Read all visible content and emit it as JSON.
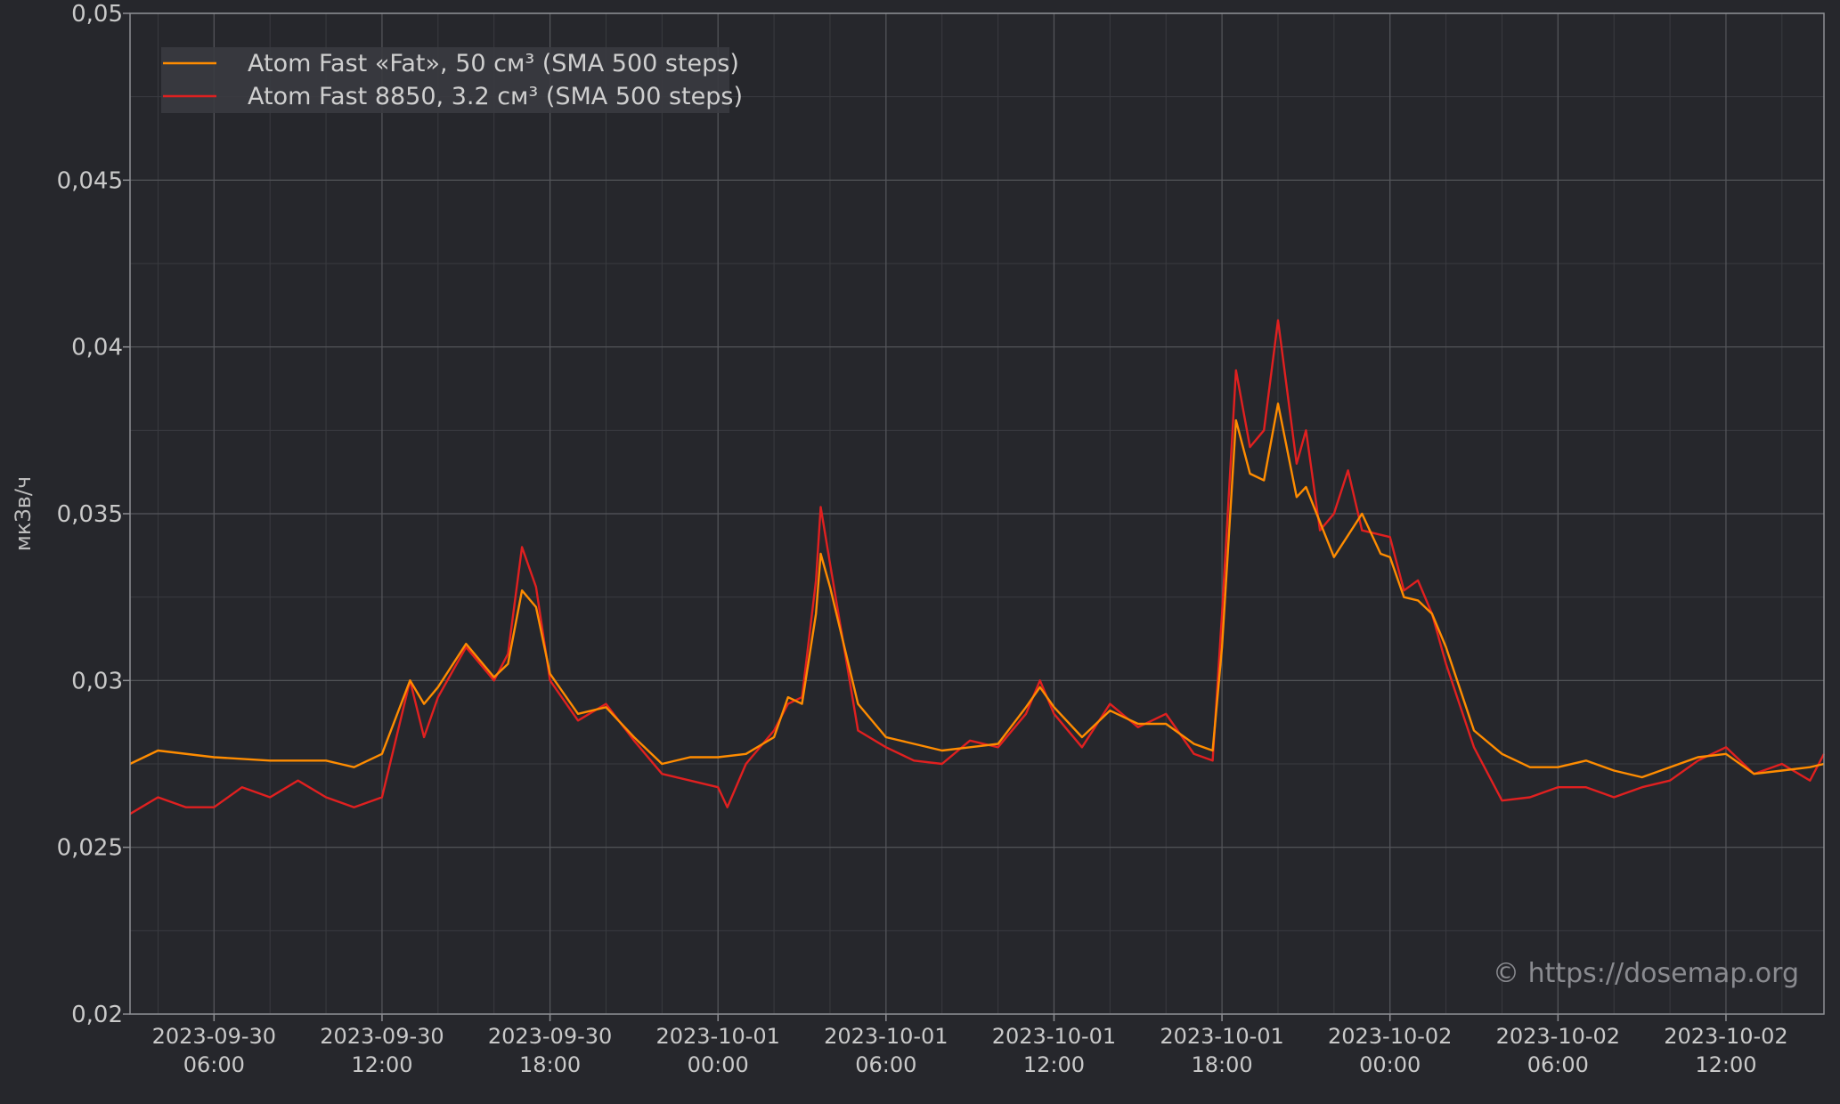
{
  "chart_data": {
    "type": "line",
    "title": "",
    "xlabel": "",
    "ylabel": "мкЗв/ч",
    "ylim": [
      0.02,
      0.05
    ],
    "y_ticks": [
      "0,02",
      "0,025",
      "0,03",
      "0,035",
      "0,04",
      "0,045",
      "0,05"
    ],
    "y_tick_values": [
      0.02,
      0.025,
      0.03,
      0.035,
      0.04,
      0.045,
      0.05
    ],
    "xlim": [
      "2023-09-30 03:00",
      "2023-10-02 15:30"
    ],
    "x_ticks": [
      {
        "date": "2023-09-30",
        "time": "06:00",
        "at": "2023-09-30 06:00"
      },
      {
        "date": "2023-09-30",
        "time": "12:00",
        "at": "2023-09-30 12:00"
      },
      {
        "date": "2023-09-30",
        "time": "18:00",
        "at": "2023-09-30 18:00"
      },
      {
        "date": "2023-10-01",
        "time": "00:00",
        "at": "2023-10-01 00:00"
      },
      {
        "date": "2023-10-01",
        "time": "06:00",
        "at": "2023-10-01 06:00"
      },
      {
        "date": "2023-10-01",
        "time": "12:00",
        "at": "2023-10-01 12:00"
      },
      {
        "date": "2023-10-01",
        "time": "18:00",
        "at": "2023-10-01 18:00"
      },
      {
        "date": "2023-10-02",
        "time": "00:00",
        "at": "2023-10-02 00:00"
      },
      {
        "date": "2023-10-02",
        "time": "06:00",
        "at": "2023-10-02 06:00"
      },
      {
        "date": "2023-10-02",
        "time": "12:00",
        "at": "2023-10-02 12:00"
      }
    ],
    "grid": true,
    "legend_position": "top-left",
    "series": [
      {
        "name": "Atom Fast «Fat», 50 см³ (SMA 500 steps)",
        "color": "#ff8c00",
        "points": [
          [
            "2023-09-30 03:00",
            0.0275
          ],
          [
            "2023-09-30 04:00",
            0.0279
          ],
          [
            "2023-09-30 06:00",
            0.0277
          ],
          [
            "2023-09-30 08:00",
            0.0276
          ],
          [
            "2023-09-30 10:00",
            0.0276
          ],
          [
            "2023-09-30 11:00",
            0.0274
          ],
          [
            "2023-09-30 12:00",
            0.0278
          ],
          [
            "2023-09-30 13:00",
            0.03
          ],
          [
            "2023-09-30 13:30",
            0.0293
          ],
          [
            "2023-09-30 14:00",
            0.0298
          ],
          [
            "2023-09-30 15:00",
            0.0311
          ],
          [
            "2023-09-30 16:00",
            0.0301
          ],
          [
            "2023-09-30 16:30",
            0.0305
          ],
          [
            "2023-09-30 17:00",
            0.0327
          ],
          [
            "2023-09-30 17:30",
            0.0322
          ],
          [
            "2023-09-30 18:00",
            0.0302
          ],
          [
            "2023-09-30 19:00",
            0.029
          ],
          [
            "2023-09-30 20:00",
            0.0292
          ],
          [
            "2023-09-30 21:00",
            0.0283
          ],
          [
            "2023-09-30 22:00",
            0.0275
          ],
          [
            "2023-09-30 23:00",
            0.0277
          ],
          [
            "2023-10-01 00:00",
            0.0277
          ],
          [
            "2023-10-01 01:00",
            0.0278
          ],
          [
            "2023-10-01 02:00",
            0.0283
          ],
          [
            "2023-10-01 02:30",
            0.0295
          ],
          [
            "2023-10-01 03:00",
            0.0293
          ],
          [
            "2023-10-01 03:30",
            0.032
          ],
          [
            "2023-10-01 03:40",
            0.0338
          ],
          [
            "2023-10-01 04:00",
            0.0328
          ],
          [
            "2023-10-01 05:00",
            0.0293
          ],
          [
            "2023-10-01 06:00",
            0.0283
          ],
          [
            "2023-10-01 07:00",
            0.0281
          ],
          [
            "2023-10-01 08:00",
            0.0279
          ],
          [
            "2023-10-01 09:00",
            0.028
          ],
          [
            "2023-10-01 10:00",
            0.0281
          ],
          [
            "2023-10-01 11:00",
            0.0292
          ],
          [
            "2023-10-01 11:30",
            0.0298
          ],
          [
            "2023-10-01 12:00",
            0.0292
          ],
          [
            "2023-10-01 13:00",
            0.0283
          ],
          [
            "2023-10-01 14:00",
            0.0291
          ],
          [
            "2023-10-01 15:00",
            0.0287
          ],
          [
            "2023-10-01 16:00",
            0.0287
          ],
          [
            "2023-10-01 17:00",
            0.0281
          ],
          [
            "2023-10-01 17:40",
            0.0279
          ],
          [
            "2023-10-01 18:00",
            0.031
          ],
          [
            "2023-10-01 18:30",
            0.0378
          ],
          [
            "2023-10-01 19:00",
            0.0362
          ],
          [
            "2023-10-01 19:30",
            0.036
          ],
          [
            "2023-10-01 20:00",
            0.0383
          ],
          [
            "2023-10-01 20:40",
            0.0355
          ],
          [
            "2023-10-01 21:00",
            0.0358
          ],
          [
            "2023-10-01 22:00",
            0.0337
          ],
          [
            "2023-10-01 23:00",
            0.035
          ],
          [
            "2023-10-01 23:40",
            0.0338
          ],
          [
            "2023-10-02 00:00",
            0.0337
          ],
          [
            "2023-10-02 00:30",
            0.0325
          ],
          [
            "2023-10-02 01:00",
            0.0324
          ],
          [
            "2023-10-02 01:30",
            0.032
          ],
          [
            "2023-10-02 02:00",
            0.031
          ],
          [
            "2023-10-02 03:00",
            0.0285
          ],
          [
            "2023-10-02 04:00",
            0.0278
          ],
          [
            "2023-10-02 05:00",
            0.0274
          ],
          [
            "2023-10-02 06:00",
            0.0274
          ],
          [
            "2023-10-02 07:00",
            0.0276
          ],
          [
            "2023-10-02 08:00",
            0.0273
          ],
          [
            "2023-10-02 09:00",
            0.0271
          ],
          [
            "2023-10-02 10:00",
            0.0274
          ],
          [
            "2023-10-02 11:00",
            0.0277
          ],
          [
            "2023-10-02 12:00",
            0.0278
          ],
          [
            "2023-10-02 13:00",
            0.0272
          ],
          [
            "2023-10-02 14:00",
            0.0273
          ],
          [
            "2023-10-02 15:00",
            0.0274
          ],
          [
            "2023-10-02 15:30",
            0.0275
          ]
        ]
      },
      {
        "name": "Atom Fast 8850, 3.2 см³ (SMA 500 steps)",
        "color": "#e02020",
        "points": [
          [
            "2023-09-30 03:00",
            0.026
          ],
          [
            "2023-09-30 04:00",
            0.0265
          ],
          [
            "2023-09-30 05:00",
            0.0262
          ],
          [
            "2023-09-30 06:00",
            0.0262
          ],
          [
            "2023-09-30 07:00",
            0.0268
          ],
          [
            "2023-09-30 08:00",
            0.0265
          ],
          [
            "2023-09-30 09:00",
            0.027
          ],
          [
            "2023-09-30 10:00",
            0.0265
          ],
          [
            "2023-09-30 11:00",
            0.0262
          ],
          [
            "2023-09-30 12:00",
            0.0265
          ],
          [
            "2023-09-30 13:00",
            0.03
          ],
          [
            "2023-09-30 13:30",
            0.0283
          ],
          [
            "2023-09-30 14:00",
            0.0295
          ],
          [
            "2023-09-30 15:00",
            0.031
          ],
          [
            "2023-09-30 16:00",
            0.03
          ],
          [
            "2023-09-30 16:30",
            0.0308
          ],
          [
            "2023-09-30 17:00",
            0.034
          ],
          [
            "2023-09-30 17:30",
            0.0328
          ],
          [
            "2023-09-30 18:00",
            0.03
          ],
          [
            "2023-09-30 19:00",
            0.0288
          ],
          [
            "2023-09-30 20:00",
            0.0293
          ],
          [
            "2023-09-30 21:00",
            0.0282
          ],
          [
            "2023-09-30 22:00",
            0.0272
          ],
          [
            "2023-09-30 23:00",
            0.027
          ],
          [
            "2023-10-01 00:00",
            0.0268
          ],
          [
            "2023-10-01 00:20",
            0.0262
          ],
          [
            "2023-10-01 01:00",
            0.0275
          ],
          [
            "2023-10-01 02:00",
            0.0285
          ],
          [
            "2023-10-01 02:30",
            0.0293
          ],
          [
            "2023-10-01 03:00",
            0.0295
          ],
          [
            "2023-10-01 03:30",
            0.033
          ],
          [
            "2023-10-01 03:40",
            0.0352
          ],
          [
            "2023-10-01 04:00",
            0.0335
          ],
          [
            "2023-10-01 05:00",
            0.0285
          ],
          [
            "2023-10-01 06:00",
            0.028
          ],
          [
            "2023-10-01 07:00",
            0.0276
          ],
          [
            "2023-10-01 08:00",
            0.0275
          ],
          [
            "2023-10-01 09:00",
            0.0282
          ],
          [
            "2023-10-01 10:00",
            0.028
          ],
          [
            "2023-10-01 11:00",
            0.029
          ],
          [
            "2023-10-01 11:30",
            0.03
          ],
          [
            "2023-10-01 12:00",
            0.029
          ],
          [
            "2023-10-01 13:00",
            0.028
          ],
          [
            "2023-10-01 14:00",
            0.0293
          ],
          [
            "2023-10-01 15:00",
            0.0286
          ],
          [
            "2023-10-01 16:00",
            0.029
          ],
          [
            "2023-10-01 17:00",
            0.0278
          ],
          [
            "2023-10-01 17:40",
            0.0276
          ],
          [
            "2023-10-01 18:00",
            0.032
          ],
          [
            "2023-10-01 18:30",
            0.0393
          ],
          [
            "2023-10-01 19:00",
            0.037
          ],
          [
            "2023-10-01 19:30",
            0.0375
          ],
          [
            "2023-10-01 20:00",
            0.0408
          ],
          [
            "2023-10-01 20:40",
            0.0365
          ],
          [
            "2023-10-01 21:00",
            0.0375
          ],
          [
            "2023-10-01 21:30",
            0.0345
          ],
          [
            "2023-10-01 22:00",
            0.035
          ],
          [
            "2023-10-01 22:30",
            0.0363
          ],
          [
            "2023-10-01 23:00",
            0.0345
          ],
          [
            "2023-10-02 00:00",
            0.0343
          ],
          [
            "2023-10-02 00:30",
            0.0327
          ],
          [
            "2023-10-02 01:00",
            0.033
          ],
          [
            "2023-10-02 01:30",
            0.032
          ],
          [
            "2023-10-02 02:00",
            0.0305
          ],
          [
            "2023-10-02 03:00",
            0.028
          ],
          [
            "2023-10-02 04:00",
            0.0264
          ],
          [
            "2023-10-02 05:00",
            0.0265
          ],
          [
            "2023-10-02 06:00",
            0.0268
          ],
          [
            "2023-10-02 07:00",
            0.0268
          ],
          [
            "2023-10-02 08:00",
            0.0265
          ],
          [
            "2023-10-02 09:00",
            0.0268
          ],
          [
            "2023-10-02 10:00",
            0.027
          ],
          [
            "2023-10-02 11:00",
            0.0276
          ],
          [
            "2023-10-02 12:00",
            0.028
          ],
          [
            "2023-10-02 13:00",
            0.0272
          ],
          [
            "2023-10-02 14:00",
            0.0275
          ],
          [
            "2023-10-02 15:00",
            0.027
          ],
          [
            "2023-10-02 15:30",
            0.0278
          ]
        ]
      }
    ],
    "watermark": "© https://dosemap.org"
  }
}
